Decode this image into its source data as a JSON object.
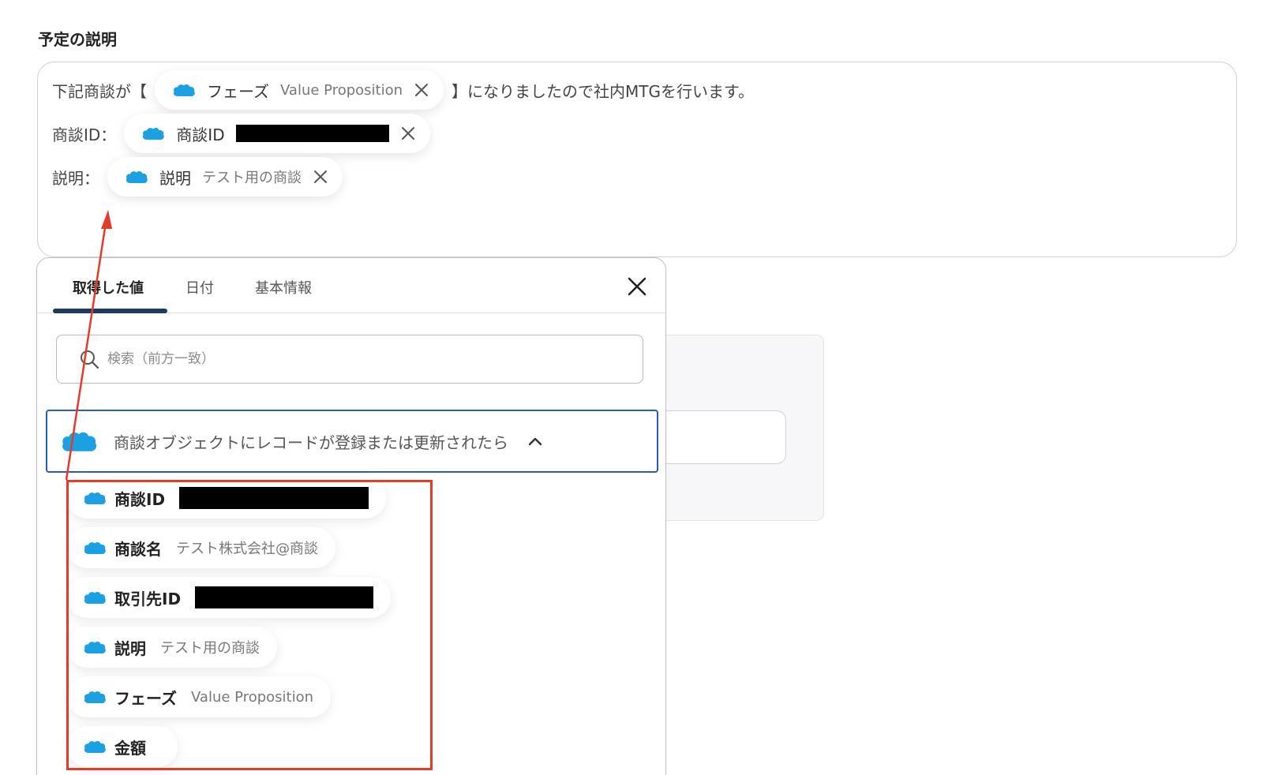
{
  "section": {
    "title": "予定の説明"
  },
  "editor": {
    "line1": {
      "prefix": "下記商談が【",
      "chip": {
        "name": "フェーズ",
        "value": "Value Proposition"
      },
      "suffix": "】になりましたので社内MTGを行います。"
    },
    "line2": {
      "prefix": "商談ID：",
      "chip": {
        "name": "商談ID"
      }
    },
    "line3": {
      "prefix": "説明：",
      "chip": {
        "name": "説明",
        "value": "テスト用の商談"
      }
    }
  },
  "popup": {
    "tabs": [
      {
        "label": "取得した値"
      },
      {
        "label": "日付"
      },
      {
        "label": "基本情報"
      }
    ],
    "search": {
      "placeholder": "検索（前方一致）"
    },
    "group": {
      "label": "商談オブジェクトにレコードが登録または更新されたら"
    },
    "items": [
      {
        "name": "商談ID",
        "value": ""
      },
      {
        "name": "商談名",
        "value": "テスト株式会社@商談"
      },
      {
        "name": "取引先ID",
        "value": ""
      },
      {
        "name": "説明",
        "value": "テスト用の商談"
      },
      {
        "name": "フェーズ",
        "value": "Value Proposition"
      },
      {
        "name": "金額",
        "value": ""
      }
    ]
  },
  "colors": {
    "salesforce_blue": "#1ba0e2",
    "highlight_red": "#e33a2a",
    "group_border": "#2b5bb5",
    "tab_underline": "#1e3a5f"
  },
  "icons": {
    "app": "salesforce-cloud-icon",
    "close": "close-icon",
    "search": "search-icon",
    "collapse": "chevron-up-icon"
  }
}
